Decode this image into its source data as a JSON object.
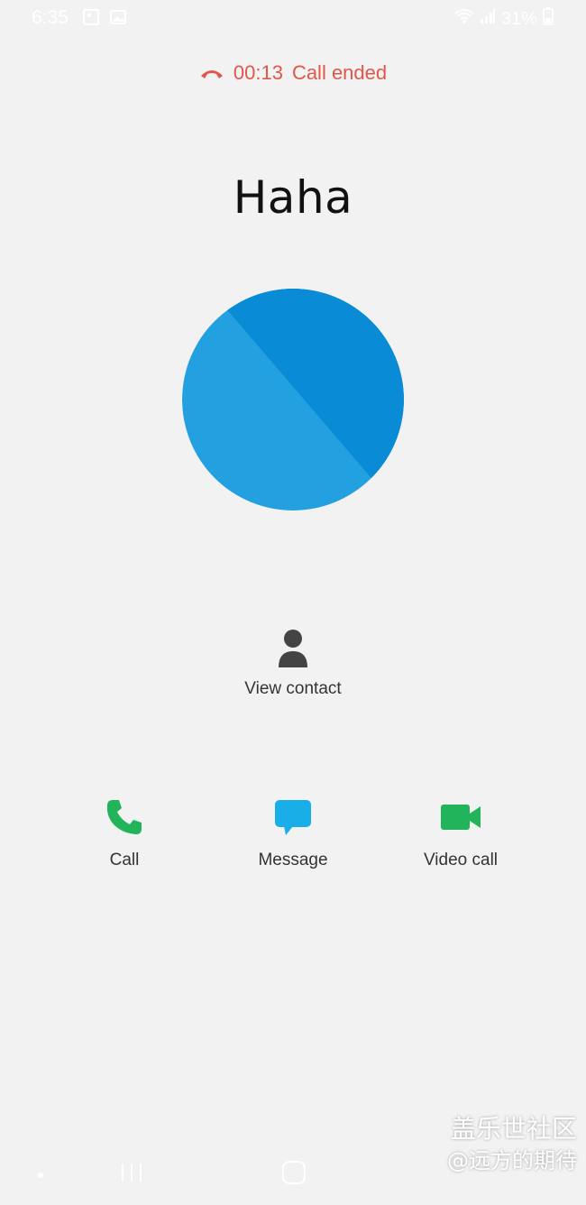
{
  "status_bar": {
    "time": "6:35",
    "battery": "31%"
  },
  "call": {
    "duration": "00:13",
    "status": "Call ended",
    "status_color": "#e0574a"
  },
  "contact": {
    "name": "Haha",
    "avatar_colors": [
      "#0a8bd6",
      "#23a0e0"
    ]
  },
  "view_contact": {
    "label": "View contact",
    "icon": "person-icon"
  },
  "actions": [
    {
      "label": "Call",
      "icon": "phone-icon",
      "color": "#21b45a"
    },
    {
      "label": "Message",
      "icon": "message-icon",
      "color": "#1aaee8"
    },
    {
      "label": "Video call",
      "icon": "video-icon",
      "color": "#21b45a"
    }
  ],
  "watermark": {
    "line1": "盖乐世社区",
    "line2": "@远方的期待"
  }
}
